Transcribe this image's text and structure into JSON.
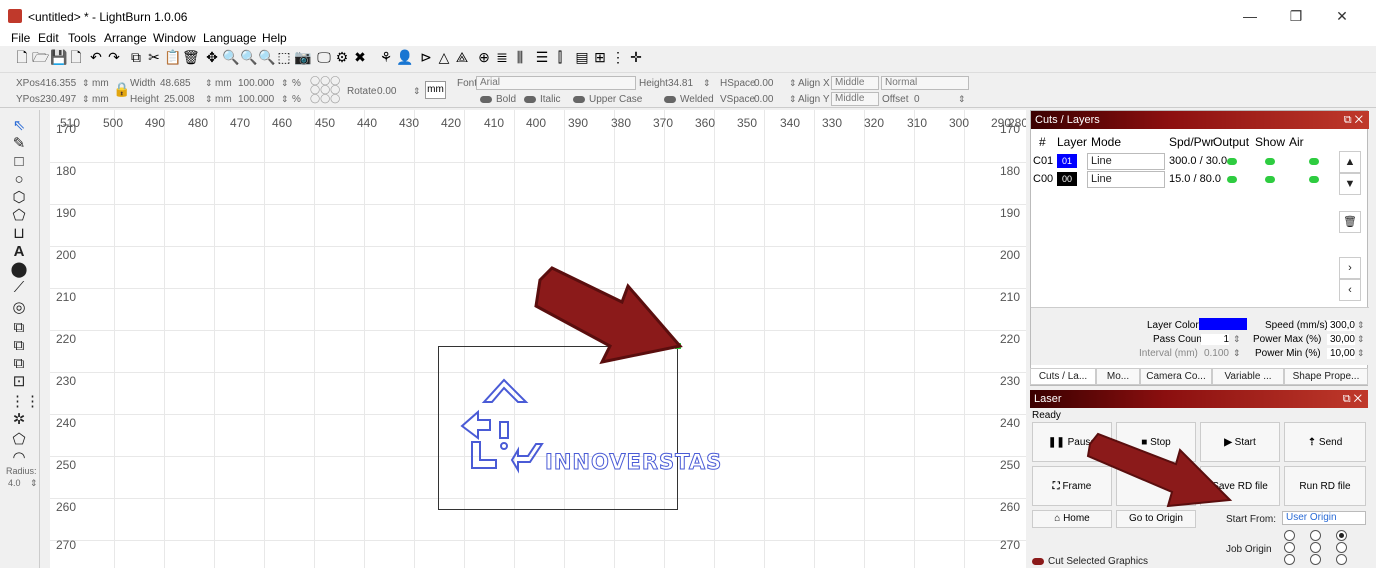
{
  "window": {
    "title": "<untitled> * - LightBurn 1.0.06",
    "minimize": "—",
    "restore": "❐",
    "close": "✕"
  },
  "menu": [
    "File",
    "Edit",
    "Tools",
    "Arrange",
    "Window",
    "Language",
    "Help"
  ],
  "props": {
    "xpos_label": "XPos",
    "xpos": "416.355",
    "ypos_label": "YPos",
    "ypos": "230.497",
    "unit_mm": "mm",
    "width_label": "Width",
    "width": "48.685",
    "height_label": "Height",
    "height": "25.008",
    "pct1": "100.000",
    "pct2": "100.000",
    "pct": "%",
    "rotate_label": "Rotate",
    "rotate": "0.00",
    "mm_button": "mm",
    "font_label": "Font",
    "font": "Arial",
    "fheight_label": "Height",
    "fheight": "34.81",
    "hspace_label": "HSpace",
    "hspace": "0.00",
    "vspace_label": "VSpace",
    "vspace": "0.00",
    "alignx_label": "Align X",
    "alignx": "Middle",
    "aligny_label": "Align Y",
    "aligny": "Middle",
    "normal": "Normal",
    "offset_label": "Offset",
    "offset": "0",
    "bold": "Bold",
    "italic": "Italic",
    "upper": "Upper Case",
    "welded": "Welded"
  },
  "leftpanel": {
    "radius_label": "Radius:",
    "radius": "4.0"
  },
  "ruler": {
    "x": [
      "510",
      "500",
      "490",
      "480",
      "470",
      "460",
      "450",
      "440",
      "430",
      "420",
      "410",
      "400",
      "390",
      "380",
      "370",
      "360",
      "350",
      "340",
      "330",
      "320",
      "310",
      "300",
      "290",
      "280"
    ],
    "y_corner": "170",
    "y": [
      "180",
      "190",
      "200",
      "210",
      "220",
      "230",
      "240",
      "250",
      "260",
      "270"
    ]
  },
  "artwork": {
    "text": "INNOVERSTAS"
  },
  "cuts": {
    "title": "Cuts / Layers",
    "headers": [
      "#",
      "Layer",
      "Mode",
      "Spd/Pwr",
      "Output",
      "Show",
      "Air"
    ],
    "rows": [
      {
        "num": "C01",
        "layer": "01",
        "color": "#0000ff",
        "mode": "Line",
        "spdpwr": "300.0 / 30.0"
      },
      {
        "num": "C00",
        "layer": "00",
        "color": "#000000",
        "mode": "Line",
        "spdpwr": "15.0 / 80.0"
      }
    ],
    "layer_color_label": "Layer Color",
    "speed_label": "Speed (mm/s)",
    "speed": "300,0",
    "pass_label": "Pass Count",
    "pass": "1",
    "pmax_label": "Power Max (%)",
    "pmax": "30,00",
    "interval_label": "Interval (mm)",
    "interval": "0.100",
    "pmin_label": "Power Min (%)",
    "pmin": "10,00"
  },
  "tabs": [
    "Cuts / La...",
    "Mo...",
    "Camera Co...",
    "Variable ...",
    "Shape Prope..."
  ],
  "laser": {
    "title": "Laser",
    "status": "Ready",
    "pause": "Pause",
    "stop": "Stop",
    "start": "Start",
    "send": "Send",
    "frame": "Frame",
    "save_rd": "Save RD file",
    "run_rd": "Run RD file",
    "home": "Home",
    "goto_origin": "Go to Origin",
    "start_from_label": "Start From:",
    "start_from": "User Origin",
    "job_origin_label": "Job Origin",
    "cut_selected": "Cut Selected Graphics"
  },
  "colors": {
    "accent_red": "#8b1a1a",
    "layer_blue": "#0000ff",
    "toggle_green": "#2ecc40"
  }
}
